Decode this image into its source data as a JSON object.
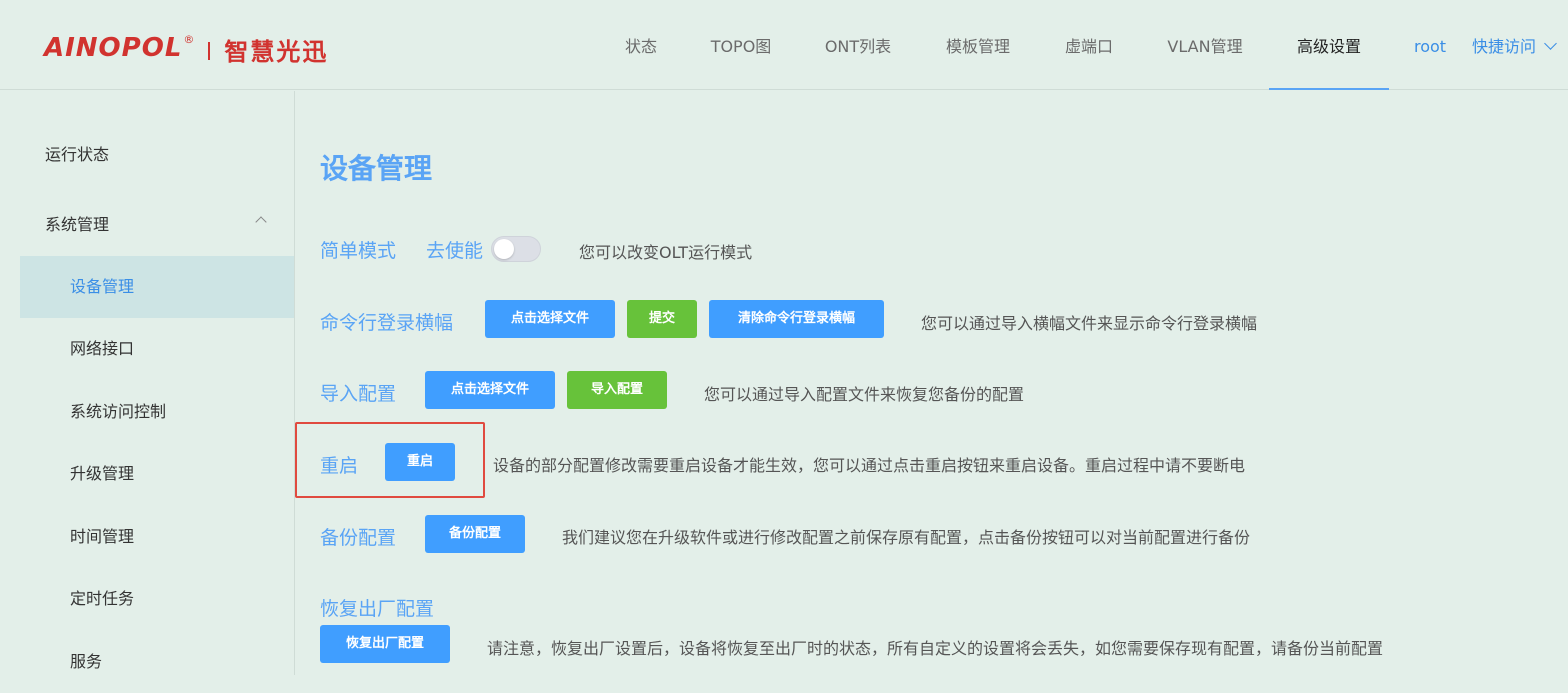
{
  "header": {
    "logo_brand": "AINOPOL",
    "logo_reg": "®",
    "logo_cn": "智慧光迅",
    "nav": [
      {
        "label": "状态"
      },
      {
        "label": "TOPO图"
      },
      {
        "label": "ONT列表"
      },
      {
        "label": "模板管理"
      },
      {
        "label": "虚端口"
      },
      {
        "label": "VLAN管理"
      },
      {
        "label": "高级设置",
        "active": true
      }
    ],
    "user": "root",
    "quick_access": "快捷访问"
  },
  "sidebar": {
    "items": [
      {
        "label": "运行状态"
      },
      {
        "label": "系统管理",
        "expanded": true
      }
    ],
    "subitems": [
      {
        "label": "设备管理",
        "active": true
      },
      {
        "label": "网络接口"
      },
      {
        "label": "系统访问控制"
      },
      {
        "label": "升级管理"
      },
      {
        "label": "时间管理"
      },
      {
        "label": "定时任务"
      },
      {
        "label": "服务"
      }
    ]
  },
  "main": {
    "title": "设备管理",
    "simple_mode": {
      "label": "简单模式",
      "state_label": "去使能",
      "enabled": false,
      "desc": "您可以改变OLT运行模式"
    },
    "banner": {
      "label": "命令行登录横幅",
      "choose_file": "点击选择文件",
      "submit": "提交",
      "clear": "清除命令行登录横幅",
      "desc": "您可以通过导入横幅文件来显示命令行登录横幅"
    },
    "import_config": {
      "label": "导入配置",
      "choose_file": "点击选择文件",
      "import": "导入配置",
      "desc": "您可以通过导入配置文件来恢复您备份的配置"
    },
    "reboot": {
      "label": "重启",
      "button": "重启",
      "desc": "设备的部分配置修改需要重启设备才能生效，您可以通过点击重启按钮来重启设备。重启过程中请不要断电"
    },
    "backup": {
      "label": "备份配置",
      "button": "备份配置",
      "desc": "我们建议您在升级软件或进行修改配置之前保存原有配置，点击备份按钮可以对当前配置进行备份"
    },
    "factory_reset": {
      "label": "恢复出厂配置",
      "button": "恢复出厂配置",
      "desc": "请注意，恢复出厂设置后，设备将恢复至出厂时的状态，所有自定义的设置将会丢失，如您需要保存现有配置，请备份当前配置"
    }
  },
  "colors": {
    "accent": "#409eff",
    "green": "#67c23a",
    "brand_red": "#d1332f",
    "highlight": "#e04a3f",
    "background": "#e3efe9"
  }
}
